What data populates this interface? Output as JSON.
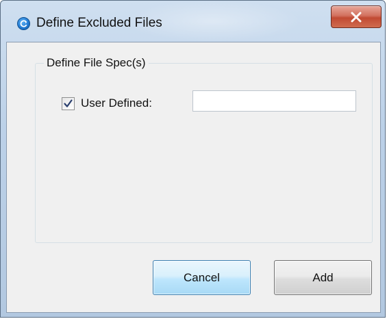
{
  "window": {
    "title": "Define Excluded Files",
    "close_glyph": "X"
  },
  "groupbox": {
    "legend": "Define File Spec(s)"
  },
  "user_defined": {
    "label": "User Defined:",
    "checked": true,
    "value": "",
    "placeholder": ""
  },
  "buttons": {
    "cancel_label": "Cancel",
    "add_label": "Add"
  },
  "icons": {
    "app": "refresh-icon",
    "close": "close-icon",
    "check": "checkmark-icon"
  },
  "colors": {
    "titlebar": "#bcd1e8",
    "close_button": "#c14a33",
    "client_background": "#f0f0f0",
    "focused_button_border": "#3c7fb1"
  }
}
